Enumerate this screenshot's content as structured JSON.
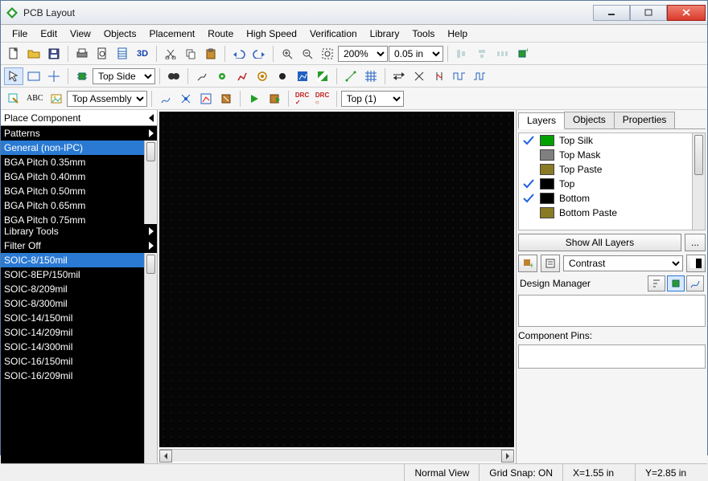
{
  "window": {
    "title": "PCB Layout"
  },
  "menus": [
    "File",
    "Edit",
    "View",
    "Objects",
    "Placement",
    "Route",
    "High Speed",
    "Verification",
    "Library",
    "Tools",
    "Help"
  ],
  "toolbar1": {
    "threeD": "3D",
    "zoom_value": "200%",
    "grid_value": "0.05 in"
  },
  "toolbar2": {
    "layer_select": "Top Side"
  },
  "toolbar3": {
    "assy_select": "Top Assembly",
    "top_select": "Top (1)"
  },
  "left_panel": {
    "title": "Place Component",
    "sections": {
      "patterns": "Patterns",
      "library_tools": "Library Tools",
      "filter": "Filter Off"
    },
    "patterns_list": [
      "General (non-IPC)",
      "BGA Pitch 0.35mm",
      "BGA Pitch 0.40mm",
      "BGA Pitch 0.50mm",
      "BGA Pitch 0.65mm",
      "BGA Pitch 0.75mm"
    ],
    "footprints_list": [
      "SOIC-8/150mil",
      "SOIC-8EP/150mil",
      "SOIC-8/209mil",
      "SOIC-8/300mil",
      "SOIC-14/150mil",
      "SOIC-14/209mil",
      "SOIC-14/300mil",
      "SOIC-16/150mil",
      "SOIC-16/209mil"
    ]
  },
  "right_panel": {
    "tabs": [
      "Layers",
      "Objects",
      "Properties"
    ],
    "layers": [
      {
        "name": "Top Silk",
        "color": "#00a000",
        "checked": true
      },
      {
        "name": "Top Mask",
        "color": "#808080",
        "checked": false
      },
      {
        "name": "Top Paste",
        "color": "#8a7a23",
        "checked": false
      },
      {
        "name": "Top",
        "color": "#000000",
        "checked": true
      },
      {
        "name": "Bottom",
        "color": "#000000",
        "checked": true
      },
      {
        "name": "Bottom Paste",
        "color": "#8a7a23",
        "checked": false
      }
    ],
    "show_all_label": "Show All Layers",
    "more_label": "...",
    "contrast_label": "Contrast",
    "design_manager": "Design Manager",
    "component_pins": "Component Pins:"
  },
  "statusbar": {
    "view": "Normal View",
    "grid": "Grid Snap: ON",
    "x": "X=1.55 in",
    "y": "Y=2.85 in"
  }
}
